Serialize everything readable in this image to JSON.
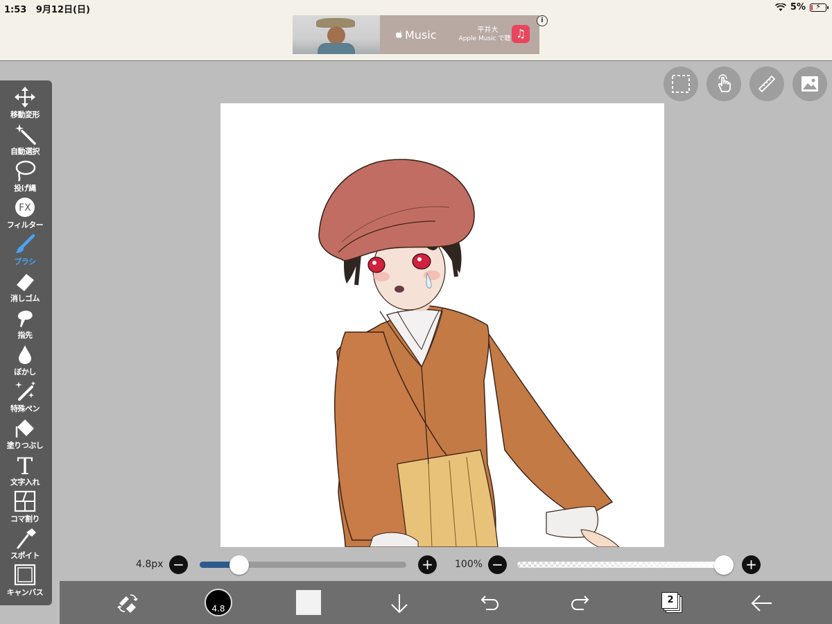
{
  "status_bar": {
    "time": "1:53",
    "date": "9月12日(日)",
    "battery": "5%",
    "battery_level": 0.05
  },
  "ad": {
    "brand": "Music",
    "artist": "平井大",
    "cta": "Apple Music で聴く",
    "info": "i"
  },
  "tools": [
    {
      "label": "移動変形",
      "icon": "move-arrows-icon"
    },
    {
      "label": "自動選択",
      "icon": "magic-wand-icon"
    },
    {
      "label": "投げ縄",
      "icon": "lasso-icon"
    },
    {
      "label": "フィルター",
      "icon": "fx-icon",
      "icon_text": "FX"
    },
    {
      "label": "ブラシ",
      "icon": "brush-icon",
      "active": true
    },
    {
      "label": "消しゴム",
      "icon": "eraser-icon"
    },
    {
      "label": "指先",
      "icon": "finger-smudge-icon"
    },
    {
      "label": "ぼかし",
      "icon": "blur-drop-icon"
    },
    {
      "label": "特殊ペン",
      "icon": "special-pen-icon"
    },
    {
      "label": "塗りつぶし",
      "icon": "fill-bucket-icon"
    },
    {
      "label": "文字入れ",
      "icon": "text-icon",
      "icon_text": "T"
    },
    {
      "label": "コマ割り",
      "icon": "frame-divider-icon"
    },
    {
      "label": "スポイト",
      "icon": "eyedropper-icon"
    },
    {
      "label": "キャンバス",
      "icon": "canvas-icon"
    }
  ],
  "top_buttons": [
    "selection-icon",
    "touch-gesture-icon",
    "ruler-icon",
    "image-material-icon"
  ],
  "brush": {
    "size_label": "4.8px",
    "size_fraction": 0.165
  },
  "opacity": {
    "label": "100%",
    "fraction": 1.0
  },
  "buttons": {
    "minus": "−",
    "plus": "+"
  },
  "bottom_bar": {
    "color_size": "4.8",
    "layer_count": "2"
  },
  "colors": {
    "accent": "#4aa3ee",
    "toolbar": "#5a5a5a",
    "bottom_bar": "#6e6e6e",
    "background": "#bdbdbd",
    "slider_fill": "#2c5a8c"
  }
}
